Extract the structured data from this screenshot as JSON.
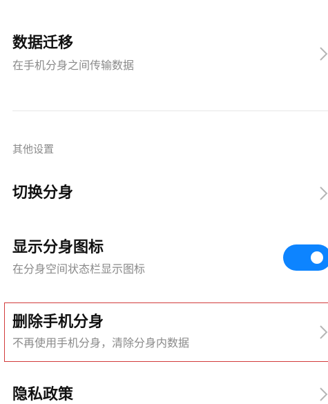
{
  "items": [
    {
      "title": "数据迁移",
      "subtitle": "在手机分身之间传输数据"
    },
    {
      "title": "切换分身"
    },
    {
      "title": "显示分身图标",
      "subtitle": "在分身空间状态栏显示图标",
      "toggle_on": true
    },
    {
      "title": "删除手机分身",
      "subtitle": "不再使用手机分身，清除分身内数据",
      "highlighted": true
    },
    {
      "title": "隐私政策"
    }
  ],
  "section_label": "其他设置",
  "colors": {
    "toggle_on": "#0d84ff",
    "highlight_border": "#d23a3a",
    "subtitle": "#8a8a8a"
  }
}
